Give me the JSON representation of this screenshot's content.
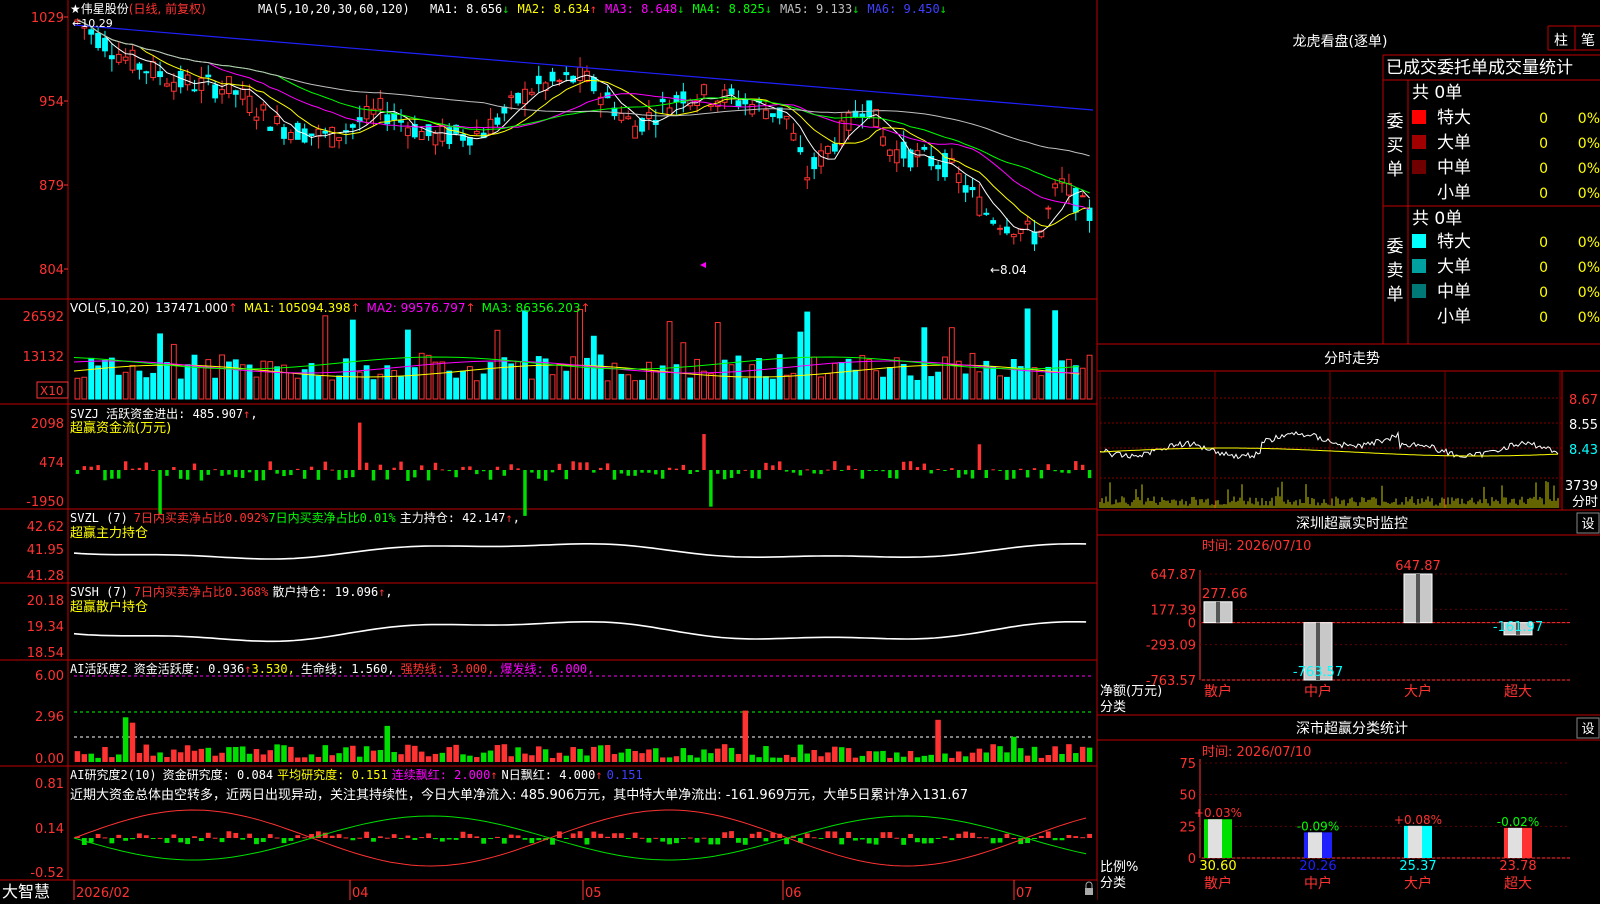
{
  "app": {
    "logo": "大智慧",
    "lock_icon": "lock-icon"
  },
  "colors": {
    "up": "#ff3232",
    "down": "#00ffff",
    "white": "#ffffff",
    "yellow": "#ffff00",
    "magenta": "#ff00ff",
    "green": "#00e000",
    "blue": "#2020ff",
    "grey": "#c0c0c0",
    "frame": "#c00000"
  },
  "main_chart": {
    "title_star": "★",
    "stock": "伟星股份",
    "period": "(日线, 前复权)",
    "ma_label": "MA(5,10,20,30,60,120)",
    "ma_values": [
      {
        "name": "MA1:",
        "value": "8.656",
        "arrow": "↓",
        "color": "#ffffff"
      },
      {
        "name": "MA2:",
        "value": "8.634",
        "arrow": "↑",
        "color": "#ffff00"
      },
      {
        "name": "MA3:",
        "value": "8.648",
        "arrow": "↓",
        "color": "#ff00ff"
      },
      {
        "name": "MA4:",
        "value": "8.825",
        "arrow": "↓",
        "color": "#00ff00"
      },
      {
        "name": "MA5:",
        "value": "9.133",
        "arrow": "↓",
        "color": "#c0c0c0"
      },
      {
        "name": "MA6:",
        "value": "9.450",
        "arrow": "↓",
        "color": "#4040ff"
      }
    ],
    "y_ticks": [
      "1029",
      "954",
      "879",
      "804"
    ],
    "hi_label": "←10.29",
    "lo_label": "←8.04",
    "dates": [
      "2026/02",
      "04",
      "05",
      "06",
      "07"
    ]
  },
  "vol_panel": {
    "label": "VOL(5,10,20)",
    "vol": "137471.000",
    "ma1": "MA1: 105094.398",
    "ma2": "MA2: 99576.797",
    "ma3": "MA3: 86356.203",
    "y_ticks": [
      "26592",
      "13132"
    ],
    "unit": "X10"
  },
  "svzj": {
    "label": "SVZJ  活跃资金进出: 485.907",
    "sub": "超赢资金流(万元)",
    "y_ticks": [
      "2098",
      "474",
      "-1950"
    ]
  },
  "svzl": {
    "label": "SVZL (7)",
    "p1": "7日内买卖净占比0.092%",
    "p2": "7日内买卖净占比0.01%",
    "p3": "主力持仓: 42.147",
    "sub": "超赢主力持仓",
    "y_ticks": [
      "42.62",
      "41.95",
      "41.28"
    ]
  },
  "svsh": {
    "label": "SVSH (7)",
    "p1": "7日内买卖净占比0.368%",
    "p2": "散户持仓: 19.096",
    "sub": "超赢散户持仓",
    "y_ticks": [
      "20.18",
      "19.34",
      "18.54"
    ]
  },
  "ai_active": {
    "label": "AI活跃度2",
    "p1": "资金活跃度: 0.936",
    "p2": "3.530,",
    "p3": "生命线: 1.560,",
    "p4": "强势线: 3.000,",
    "p5": "爆发线: 6.000,",
    "y_ticks": [
      "6.00",
      "2.96",
      "0.00"
    ]
  },
  "ai_research": {
    "label": "AI研究度2(10)",
    "p1": "资金研究度: 0.084",
    "p2": "平均研究度: 0.151",
    "p3": "连续飘红: 2.000",
    "p4": "N日飘红: 4.000",
    "p5": "0.151",
    "comment": "近期大资金总体由空转多，近两日出现异动，关注其持续性，今日大单净流入: 485.906万元，其中特大单净流出: -161.969万元，大单5日累计净入131.67",
    "y_ticks": [
      "0.81",
      "0.14",
      "-0.52"
    ]
  },
  "longhu": {
    "title": "龙虎看盘(逐单)",
    "btn_zhu": "柱",
    "btn_bi": "笔",
    "tabs": "已成交委托单成交量统计",
    "buy_side": "委买单",
    "sell_side": "委卖单",
    "buy_total": "共 0单",
    "sell_total": "共 0单",
    "buy_rows": [
      {
        "label": "特大",
        "val": "0",
        "pct": "0%",
        "color": "#ff0000"
      },
      {
        "label": "大单",
        "val": "0",
        "pct": "0%",
        "color": "#a00000"
      },
      {
        "label": "中单",
        "val": "0",
        "pct": "0%",
        "color": "#700000"
      },
      {
        "label": "小单",
        "val": "0",
        "pct": "0%",
        "color": ""
      }
    ],
    "sell_rows": [
      {
        "label": "特大",
        "val": "0",
        "pct": "0%",
        "color": "#00ffff"
      },
      {
        "label": "大单",
        "val": "0",
        "pct": "0%",
        "color": "#00a0a0"
      },
      {
        "label": "中单",
        "val": "0",
        "pct": "0%",
        "color": "#007878"
      },
      {
        "label": "小单",
        "val": "0",
        "pct": "0%",
        "color": ""
      }
    ]
  },
  "intraday": {
    "title": "分时走势",
    "y_ticks": [
      "8.67",
      "8.55",
      "8.43"
    ],
    "vol_tick": "3739",
    "vol_unit": "分时"
  },
  "sz_monitor": {
    "title": "深圳超赢实时监控",
    "btn": "设",
    "time": "时间: 2026/07/10",
    "y_ticks": [
      "647.87",
      "177.39",
      "0",
      "-293.09",
      "-763.57"
    ],
    "footer1": "净额(万元)",
    "footer2": "分类",
    "chart_data": {
      "type": "bar",
      "categories": [
        "散户",
        "中户",
        "大户",
        "超大"
      ],
      "values": [
        277.66,
        -763.57,
        647.87,
        -161.97
      ],
      "labels": [
        "277.66",
        "-763.57",
        "647.87",
        "-161.97"
      ],
      "ylim": [
        -763.57,
        647.87
      ]
    }
  },
  "sz_class": {
    "title": "深市超赢分类统计",
    "btn": "设",
    "time": "时间: 2026/07/10",
    "y_ticks": [
      "75",
      "50",
      "25",
      "0"
    ],
    "footer1": "比例%",
    "footer2": "分类",
    "chart_data": {
      "type": "bar",
      "categories": [
        "散户",
        "中户",
        "大户",
        "超大"
      ],
      "values": [
        30.6,
        20.26,
        25.37,
        23.78
      ],
      "value_labels": [
        "30.60",
        "20.26",
        "25.37",
        "23.78"
      ],
      "changes": [
        "+0.03%",
        "-0.09%",
        "+0.08%",
        "-0.02%"
      ],
      "ylim": [
        0,
        75
      ]
    }
  }
}
